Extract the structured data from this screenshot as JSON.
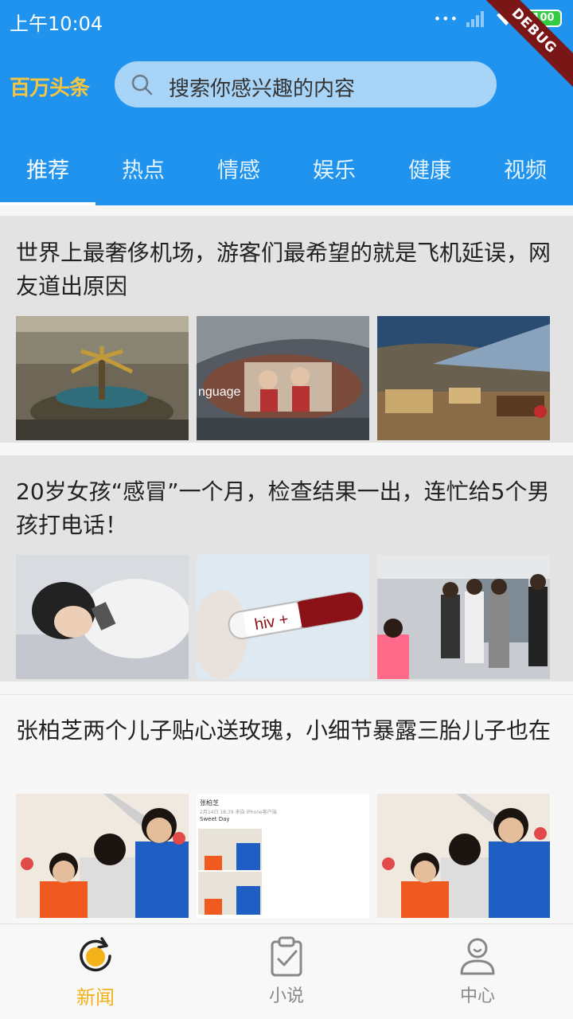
{
  "status": {
    "time": "上午10:04",
    "battery": "100",
    "debug": "DEBUG"
  },
  "header": {
    "logo": "百万头条",
    "search_placeholder": "搜索你感兴趣的内容",
    "tabs": [
      {
        "label": "推荐",
        "active": true
      },
      {
        "label": "热点"
      },
      {
        "label": "情感"
      },
      {
        "label": "娱乐"
      },
      {
        "label": "健康"
      },
      {
        "label": "视频"
      }
    ]
  },
  "feed": [
    {
      "title": "世界上最奢侈机场，游客们最希望的就是飞机延误，网友道出原因",
      "images": [
        "airport-palm-tree-hall",
        "airport-emirates-billboard",
        "airport-lounge-seating"
      ]
    },
    {
      "title": "20岁女孩“感冒”一个月，检查结果一出，连忙给5个男孩打电话！",
      "images": [
        "girl-lying-on-bed",
        "blood-test-tube",
        "hospital-waiting-line"
      ]
    },
    {
      "title": "张柏芝两个儿子贴心送玫瑰，小细节暴露三胎儿子也在",
      "images": [
        "mother-with-sons-roses",
        "weibo-post-screenshot",
        "mother-with-sons-roses"
      ]
    }
  ],
  "weibo_post": {
    "user": "张柏芝",
    "meta": "2月14日 18:39 来自 iPhone客户端",
    "text": "Sweet Day"
  },
  "billboard_text": "nguage",
  "test_tube_label": "hiv +",
  "bottom_nav": [
    {
      "label": "新闻",
      "icon": "news-refresh-icon",
      "active": true
    },
    {
      "label": "小说",
      "icon": "novel-clipboard-icon"
    },
    {
      "label": "中心",
      "icon": "user-profile-icon"
    }
  ],
  "colors": {
    "primary": "#1f93ee",
    "accent": "#f3b11a",
    "logo": "#f5c542"
  }
}
